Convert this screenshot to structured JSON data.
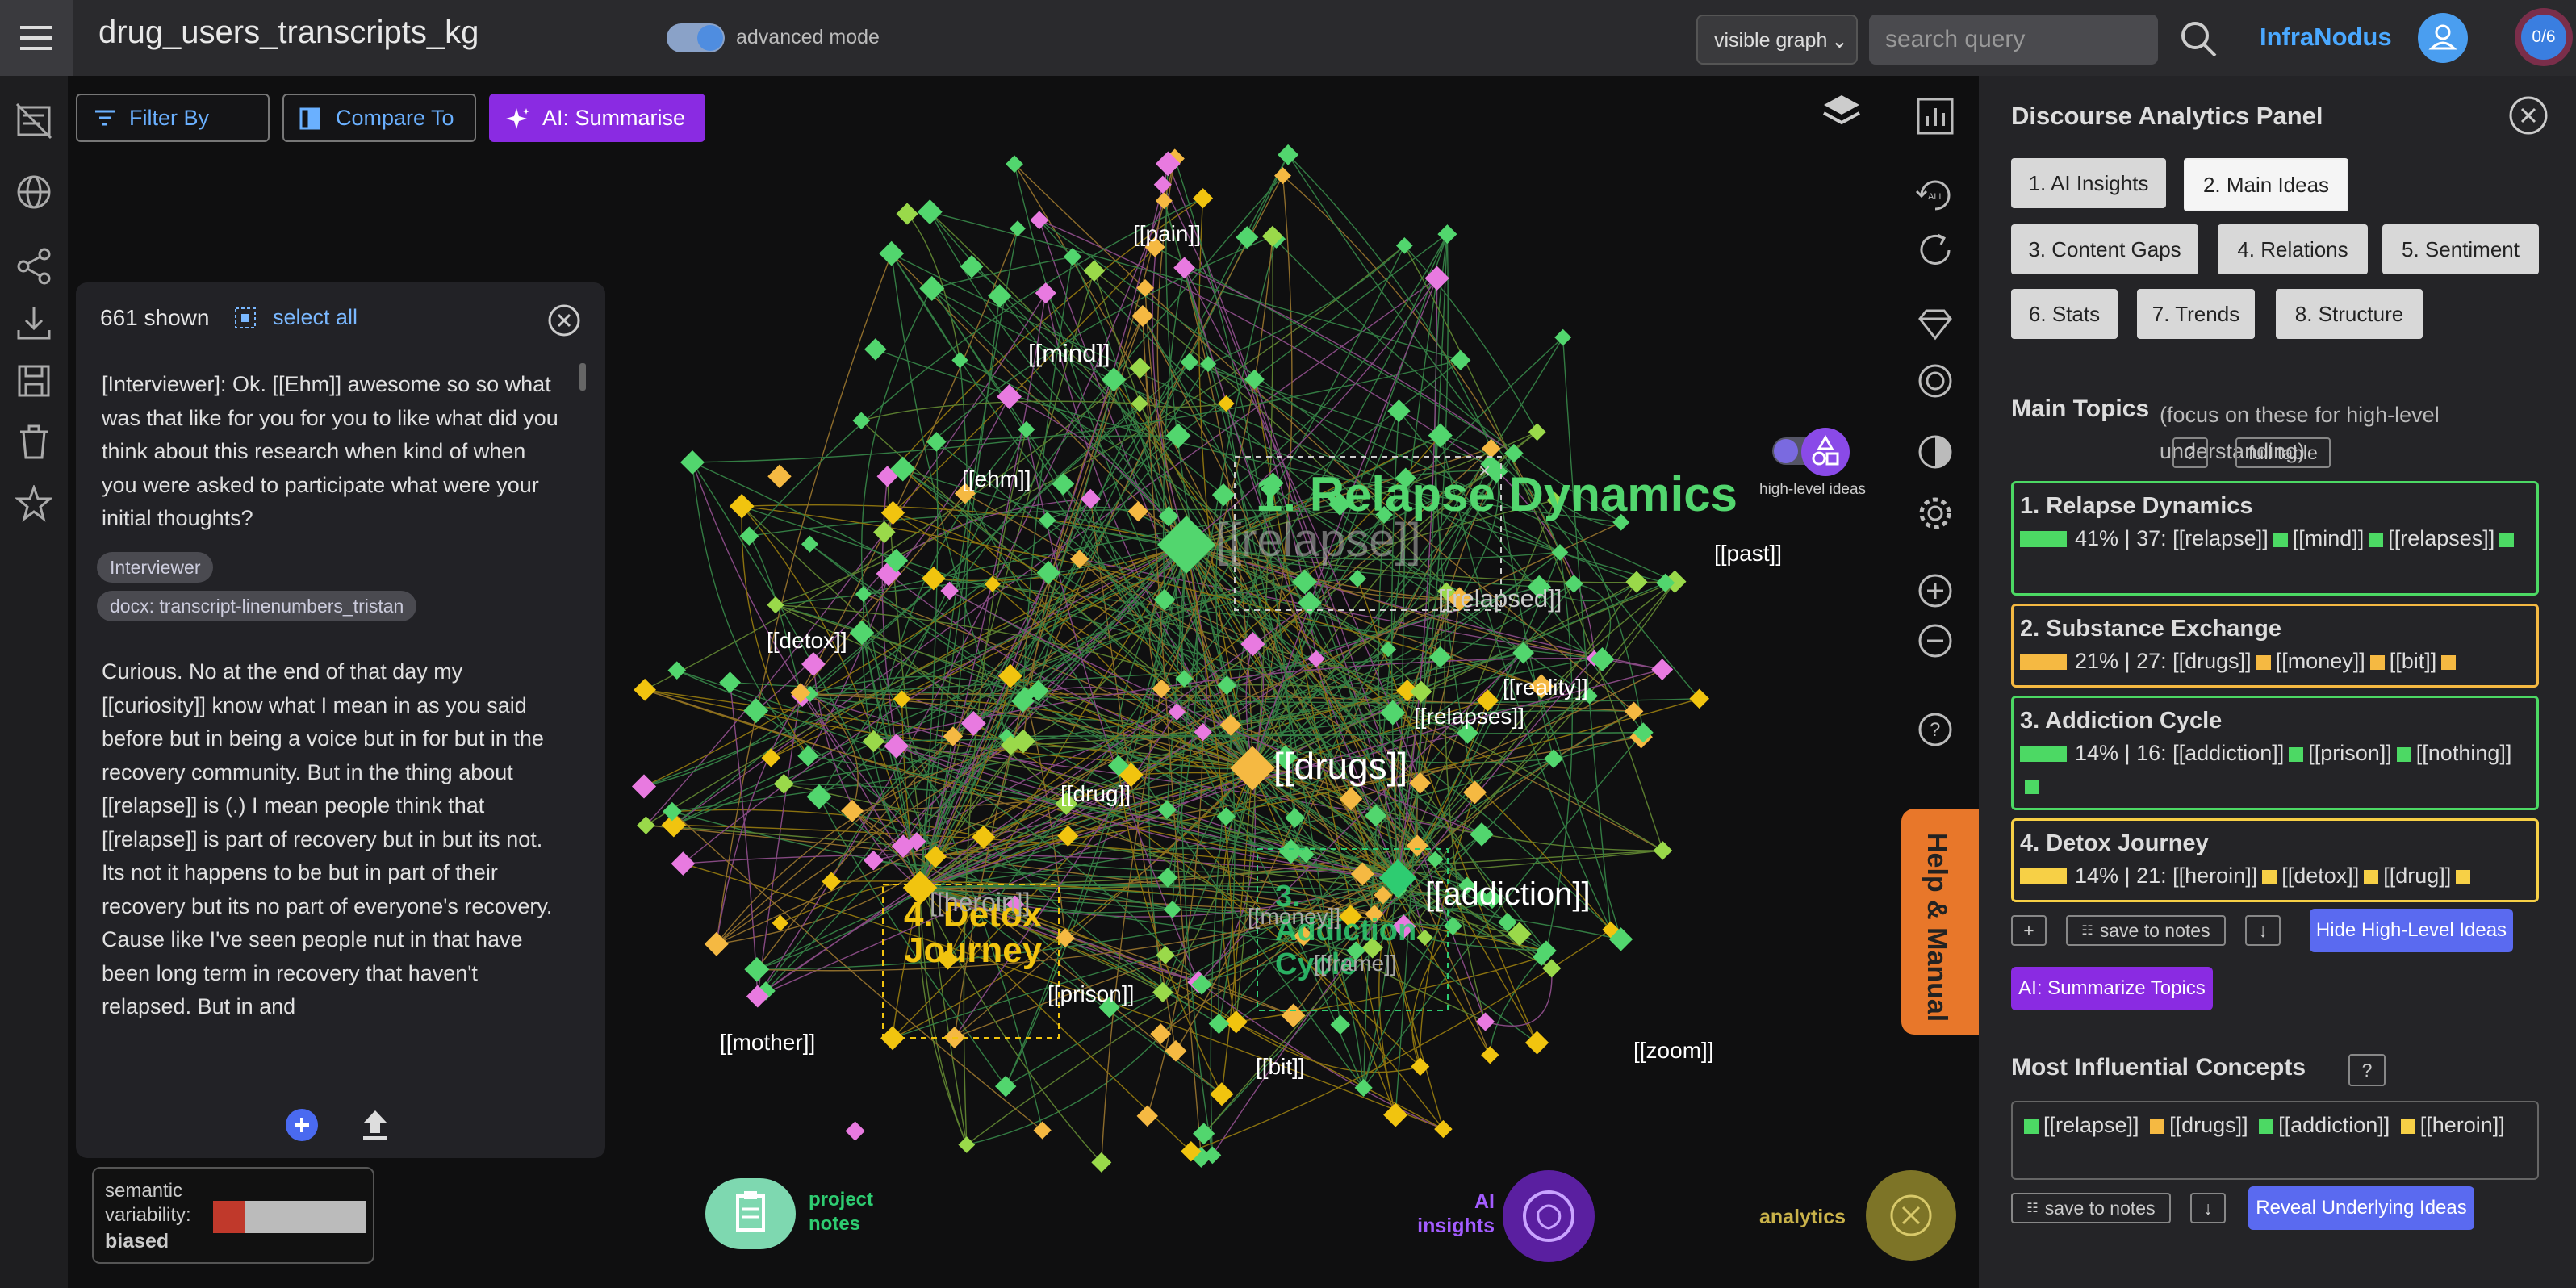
{
  "app": {
    "title": "drug_users_transcripts_kg",
    "brand": "InfraNodus",
    "advanced_mode_label": "advanced mode",
    "notif_count": "0/6"
  },
  "header": {
    "visible_select": "visible graph",
    "search_placeholder": "search query"
  },
  "toolbar": {
    "filter": "Filter By",
    "compare": "Compare To",
    "summarise": "AI: Summarise"
  },
  "textpanel": {
    "shown": "661 shown",
    "select_all": "select all",
    "para1": "[Interviewer]: Ok. [[Ehm]] awesome so so what was that like for you for you to like what did you think about this research when kind of when you were asked to participate what were your initial thoughts?",
    "tag1": "Interviewer",
    "tag2": "docx: transcript-linenumbers_tristan",
    "para2": "Curious. No at the end of that day my [[curiosity]] know what I mean in as you said before but in being a voice but in for but in the recovery community. But in the thing about [[relapse]] is (.) I mean people think that [[relapse]] is part of recovery but in but its not. Its not it happens to be but in part of their recovery but its no part of everyone's recovery. Cause like I've seen people nut in that have been long term in recovery that haven't relapsed. But in and"
  },
  "semantic": {
    "line1": "semantic",
    "line2": "variability:",
    "value": "biased"
  },
  "graph": {
    "labels": [
      "[[pain]]",
      "[[mind]]",
      "[[ehm]]",
      "[[past]]",
      "[[detox]]",
      "[[relapsed]]",
      "[[reality]]",
      "[[relapses]]",
      "[[drugs]]",
      "[[drug]]",
      "[[heroin]]",
      "[[money]]",
      "[[addiction]]",
      "[[prison]]",
      "[[frame]]",
      "[[mother]]",
      "[[zoom]]",
      "[[bit]]",
      "[[relapse]]"
    ],
    "clusters": [
      {
        "name": "1. Relapse Dynamics",
        "color": "#2ecc71"
      },
      {
        "name": "4. Detox Journey",
        "color": "#f1c40f"
      },
      {
        "name": "3. Addiction Cycle",
        "color": "#2ecc71"
      }
    ],
    "high_level_label": "high-level ideas"
  },
  "bottom": {
    "project_notes": "project notes",
    "ai_insights": "AI insights",
    "analytics": "analytics"
  },
  "help": "Help & Manual",
  "panel": {
    "title": "Discourse Analytics Panel",
    "tabs": [
      "1. AI Insights",
      "2. Main Ideas",
      "3. Content Gaps",
      "4. Relations",
      "5. Sentiment",
      "6. Stats",
      "7. Trends",
      "8. Structure"
    ],
    "main_topics_label": "Main Topics",
    "main_topics_note": "(focus on these for high-level understanding)",
    "full_table": "full table",
    "topics": [
      {
        "name": "1. Relapse Dynamics",
        "percent": "41%",
        "count": "37",
        "terms": [
          "[[relapse]]",
          "[[mind]]",
          "[[relapses]]"
        ],
        "color": "#4cd964",
        "border": "#4cd964"
      },
      {
        "name": "2. Substance Exchange",
        "percent": "21%",
        "count": "27",
        "terms": [
          "[[drugs]]",
          "[[money]]",
          "[[bit]]"
        ],
        "color": "#f5b942",
        "border": "#f5b942"
      },
      {
        "name": "3. Addiction Cycle",
        "percent": "14%",
        "count": "16",
        "terms": [
          "[[addiction]]",
          "[[prison]]",
          "[[nothing]]"
        ],
        "color": "#4cd964",
        "border": "#4cd964"
      },
      {
        "name": "4. Detox Journey",
        "percent": "14%",
        "count": "21",
        "terms": [
          "[[heroin]]",
          "[[detox]]",
          "[[drug]]"
        ],
        "color": "#f7d046",
        "border": "#f7d046"
      }
    ],
    "save_to_notes": "save to notes",
    "hide_high_level": "Hide High-Level Ideas",
    "summarize_topics": "AI: Summarize Topics",
    "influential_label": "Most Influential Concepts",
    "influential": [
      "[[relapse]]",
      "[[drugs]]",
      "[[addiction]]",
      "[[heroin]]"
    ],
    "reveal": "Reveal Underlying Ideas"
  }
}
